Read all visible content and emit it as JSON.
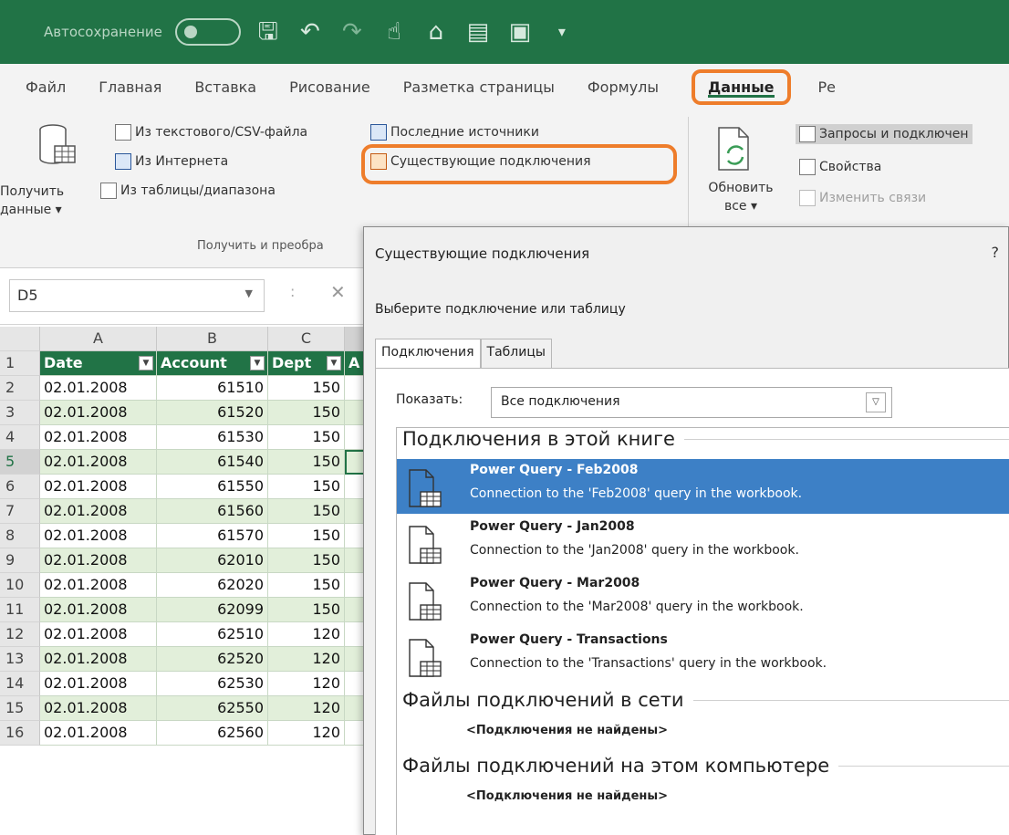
{
  "titlebar": {
    "autosave_label": "Автосохранение",
    "qa_icons": [
      "save-icon",
      "undo-icon",
      "redo-icon",
      "touch-icon",
      "folder-icon",
      "form-icon",
      "camera-icon",
      "customize-icon"
    ]
  },
  "ribbon_tabs": [
    "Файл",
    "Главная",
    "Вставка",
    "Рисование",
    "Разметка страницы",
    "Формулы",
    "Данные",
    "Ре"
  ],
  "ribbon": {
    "get_data_label_1": "Получить",
    "get_data_label_2": "данные ▾",
    "from_text_csv": "Из текстового/CSV-файла",
    "from_web": "Из Интернета",
    "from_table": "Из таблицы/диапазона",
    "recent_sources": "Последние источники",
    "existing_connections": "Существующие подключения",
    "group_get_transform": "Получить и преобра",
    "refresh_all_1": "Обновить",
    "refresh_all_2": "все ▾",
    "queries_connections": "Запросы и подключен",
    "properties": "Свойства",
    "edit_links": "Изменить связи"
  },
  "formula_bar": {
    "name_box": "D5",
    "colon": ":",
    "cancel": "✕"
  },
  "grid": {
    "col_headers": [
      "A",
      "B",
      "C"
    ],
    "header_row": [
      "Date",
      "Account",
      "Dept"
    ],
    "header_partial": "A",
    "rows": [
      {
        "n": "2",
        "date": "02.01.2008",
        "account": "61510",
        "dept": "150"
      },
      {
        "n": "3",
        "date": "02.01.2008",
        "account": "61520",
        "dept": "150"
      },
      {
        "n": "4",
        "date": "02.01.2008",
        "account": "61530",
        "dept": "150"
      },
      {
        "n": "5",
        "date": "02.01.2008",
        "account": "61540",
        "dept": "150"
      },
      {
        "n": "6",
        "date": "02.01.2008",
        "account": "61550",
        "dept": "150"
      },
      {
        "n": "7",
        "date": "02.01.2008",
        "account": "61560",
        "dept": "150"
      },
      {
        "n": "8",
        "date": "02.01.2008",
        "account": "61570",
        "dept": "150"
      },
      {
        "n": "9",
        "date": "02.01.2008",
        "account": "62010",
        "dept": "150"
      },
      {
        "n": "10",
        "date": "02.01.2008",
        "account": "62020",
        "dept": "150"
      },
      {
        "n": "11",
        "date": "02.01.2008",
        "account": "62099",
        "dept": "150"
      },
      {
        "n": "12",
        "date": "02.01.2008",
        "account": "62510",
        "dept": "120"
      },
      {
        "n": "13",
        "date": "02.01.2008",
        "account": "62520",
        "dept": "120"
      },
      {
        "n": "14",
        "date": "02.01.2008",
        "account": "62530",
        "dept": "120"
      },
      {
        "n": "15",
        "date": "02.01.2008",
        "account": "62550",
        "dept": "120"
      },
      {
        "n": "16",
        "date": "02.01.2008",
        "account": "62560",
        "dept": "120"
      }
    ]
  },
  "dialog": {
    "title": "Существующие подключения",
    "help": "?",
    "prompt": "Выберите подключение или таблицу",
    "tabs": [
      "Подключения",
      "Таблицы"
    ],
    "show_label": "Показать:",
    "show_value": "Все подключения",
    "section_workbook": "Подключения в этой книге",
    "connections": [
      {
        "name": "Power Query - Feb2008",
        "desc": "Connection to the 'Feb2008' query in the workbook."
      },
      {
        "name": "Power Query - Jan2008",
        "desc": "Connection to the 'Jan2008' query in the workbook."
      },
      {
        "name": "Power Query - Mar2008",
        "desc": "Connection to the 'Mar2008' query in the workbook."
      },
      {
        "name": "Power Query - Transactions",
        "desc": "Connection to the 'Transactions' query in the workbook."
      }
    ],
    "section_network": "Файлы подключений в сети",
    "none_found_network": "<Подключения не найдены>",
    "section_computer": "Файлы подключений на этом компьютере",
    "none_found_computer": "<Подключения не найдены>"
  },
  "colors": {
    "excel_green": "#217346",
    "highlight_orange": "#ee7d2b",
    "selection_blue": "#3d80c6",
    "band_green": "#e2efda"
  }
}
